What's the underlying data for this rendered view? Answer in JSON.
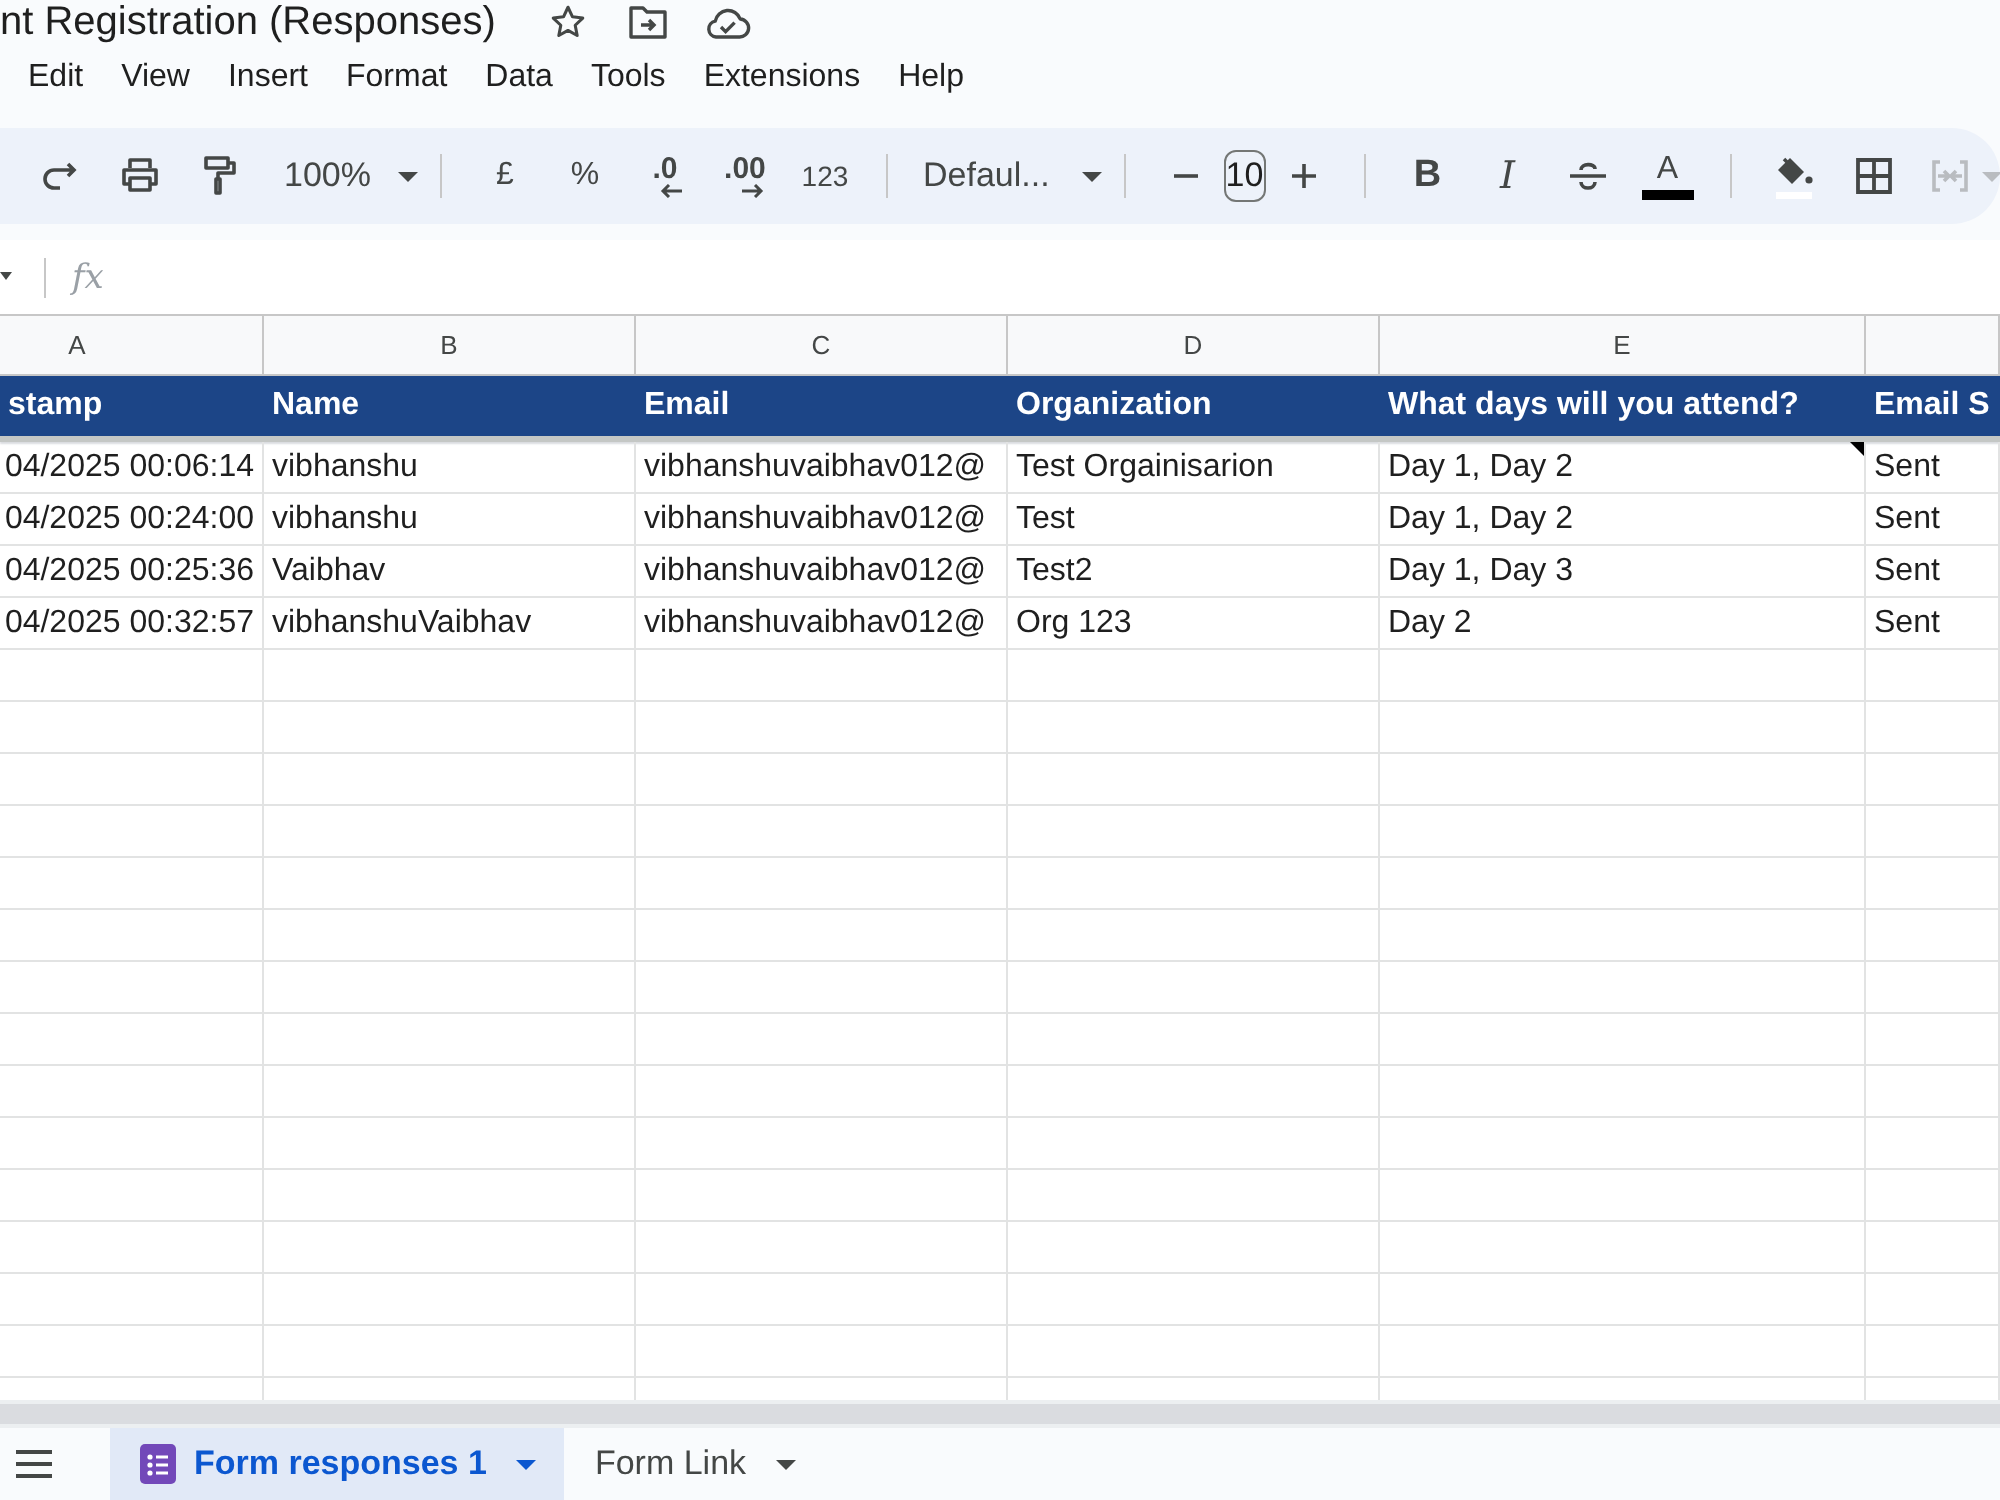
{
  "document": {
    "title": "nt Registration (Responses)"
  },
  "menu_bar": [
    "Edit",
    "View",
    "Insert",
    "Format",
    "Data",
    "Tools",
    "Extensions",
    "Help"
  ],
  "toolbar": {
    "zoom": "100%",
    "currency": "£",
    "percent": "%",
    "decimal_decrease": ".0",
    "decimal_increase": ".00",
    "number_format": "123",
    "font": "Defaul...",
    "font_size": "10",
    "bold": "B",
    "italic": "I",
    "text_color": "A",
    "merge_cells": {
      "disabled": true
    }
  },
  "formula_bar": {
    "function_label": "fx"
  },
  "sheet": {
    "column_letters": [
      "A",
      "B",
      "C",
      "D",
      "E"
    ],
    "header_row": [
      "stamp",
      "Name",
      "Email",
      "Organization",
      "What days will you attend?",
      "Email S"
    ],
    "rows": [
      {
        "cells": [
          {
            "text": "04/2025 00:06:14",
            "note": false
          },
          {
            "text": "vibhanshu",
            "note": false
          },
          {
            "text": "vibhanshuvaibhav012@",
            "note": false
          },
          {
            "text": "Test Orgainisarion",
            "note": false
          },
          {
            "text": "Day 1, Day 2",
            "note": true
          },
          {
            "text": "Sent",
            "note": false
          }
        ]
      },
      {
        "cells": [
          {
            "text": "04/2025 00:24:00",
            "note": false
          },
          {
            "text": "vibhanshu",
            "note": false
          },
          {
            "text": "vibhanshuvaibhav012@",
            "note": false
          },
          {
            "text": "Test",
            "note": false
          },
          {
            "text": "Day 1, Day 2",
            "note": false
          },
          {
            "text": "Sent",
            "note": false
          }
        ]
      },
      {
        "cells": [
          {
            "text": "04/2025 00:25:36",
            "note": false
          },
          {
            "text": "Vaibhav",
            "note": false
          },
          {
            "text": "vibhanshuvaibhav012@",
            "note": false
          },
          {
            "text": "Test2",
            "note": false
          },
          {
            "text": "Day 1, Day 3",
            "note": false
          },
          {
            "text": "Sent",
            "note": false
          }
        ]
      },
      {
        "cells": [
          {
            "text": "04/2025 00:32:57",
            "note": false
          },
          {
            "text": "vibhanshuVaibhav",
            "note": false
          },
          {
            "text": "vibhanshuvaibhav012@",
            "note": false
          },
          {
            "text": "Org 123",
            "note": false
          },
          {
            "text": "Day 2",
            "note": false
          },
          {
            "text": "Sent",
            "note": false
          }
        ]
      }
    ]
  },
  "sheet_tabs": [
    {
      "label": "Form responses 1",
      "selected": true,
      "linked_form": true
    },
    {
      "label": "Form Link",
      "selected": false,
      "linked_form": false
    }
  ]
}
